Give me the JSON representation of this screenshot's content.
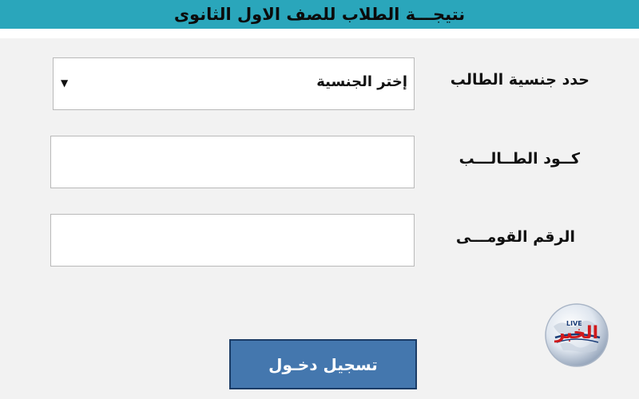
{
  "header": {
    "title": "نتيجـــة الطلاب للصف الاول الثانوى"
  },
  "form": {
    "nationality_label": "حدد جنسية الطالب",
    "nationality_select": {
      "selected": "إختر الجنسية",
      "arrow": "▼"
    },
    "student_code_label": "كــود الطــالـــب",
    "student_code_value": "",
    "national_id_label": "الرقم القومـــى",
    "national_id_value": ""
  },
  "login_button": {
    "label": "تسجيل دخـول"
  },
  "logo": {
    "text": "الخبر",
    "badge": "LIVE"
  },
  "colors": {
    "header_bg": "#2aa6bb",
    "button_bg": "#4477ae",
    "logo_red": "#d0191b"
  }
}
